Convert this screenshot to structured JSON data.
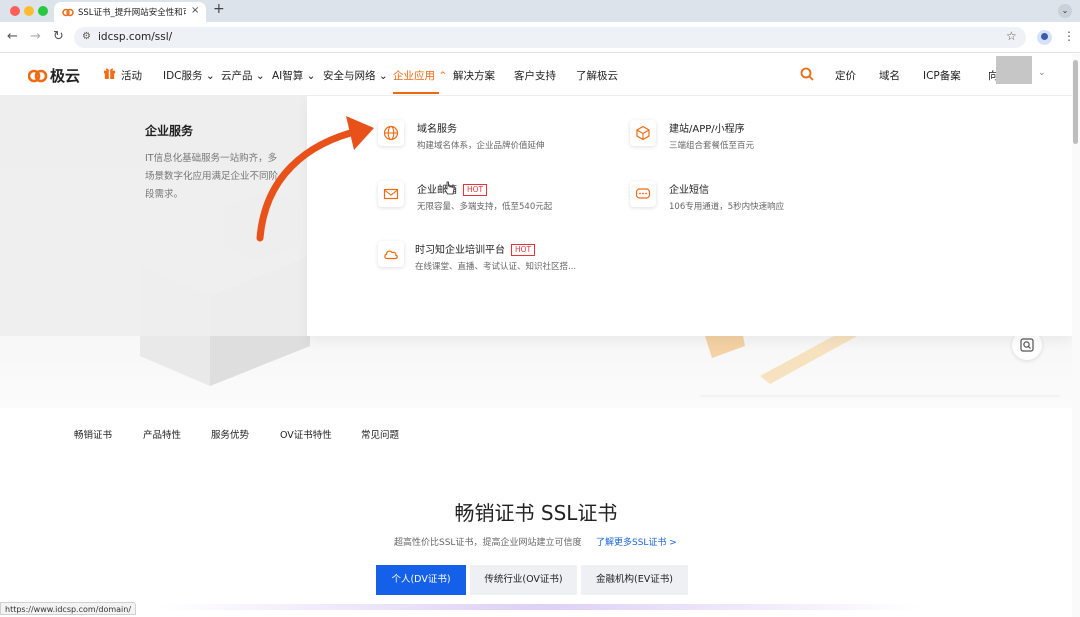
{
  "browser": {
    "tab_title": "SSL证书_提升网站安全性和可信度",
    "tab_close": "×",
    "new_tab": "+",
    "url": "idcsp.com/ssl/",
    "status_url": "https://www.idcsp.com/domain/",
    "icons": [
      "back-arrow-icon",
      "forward-arrow-icon",
      "reload-icon",
      "site-settings-icon",
      "star-icon",
      "profile-icon",
      "kebab-menu-icon"
    ]
  },
  "header": {
    "logo_text": "极云",
    "nav": {
      "activity": "活动",
      "idc": "IDC服务",
      "cloud": "云产品",
      "ai": "AI智算",
      "security": "安全与网络",
      "enterprise": "企业应用",
      "solutions": "解决方案",
      "support": "客户支持",
      "about": "了解极云"
    },
    "right": {
      "pricing": "定价",
      "domain": "域名",
      "icp": "ICP备案",
      "user": "向"
    },
    "accent_color": "#f06a12"
  },
  "dropdown": {
    "title": "企业服务",
    "description": "IT信息化基础服务一站购齐，多场景数字化应用满足企业不同阶段需求。",
    "hot_label": "HOT",
    "items": [
      {
        "title": "域名服务",
        "subtitle": "构建域名体系，企业品牌价值延伸",
        "icon": "globe-icon"
      },
      {
        "title": "建站/APP/小程序",
        "subtitle": "三端组合套餐低至百元",
        "icon": "cube-icon"
      },
      {
        "title": "企业邮箱",
        "subtitle": "无限容量、多端支持，低至540元起",
        "icon": "mail-icon",
        "hot": true
      },
      {
        "title": "企业短信",
        "subtitle": "106专用通道，5秒内快速响应",
        "icon": "sms-icon"
      },
      {
        "title": "时习知企业培训平台",
        "subtitle": "在线课堂、直播、考试认证、知识社区搭...",
        "icon": "cloud-icon",
        "hot": true
      }
    ]
  },
  "section_tabs": [
    "畅销证书",
    "产品特性",
    "服务优势",
    "OV证书特性",
    "常见问题"
  ],
  "section": {
    "title": "畅销证书 SSL证书",
    "subtitle": "超高性价比SSL证书，提高企业网站建立可信度",
    "link": "了解更多SSL证书 >",
    "buttons": [
      "个人(DV证书)",
      "传统行业(OV证书)",
      "金融机构(EV证书)"
    ],
    "primary_color": "#1560e8"
  }
}
